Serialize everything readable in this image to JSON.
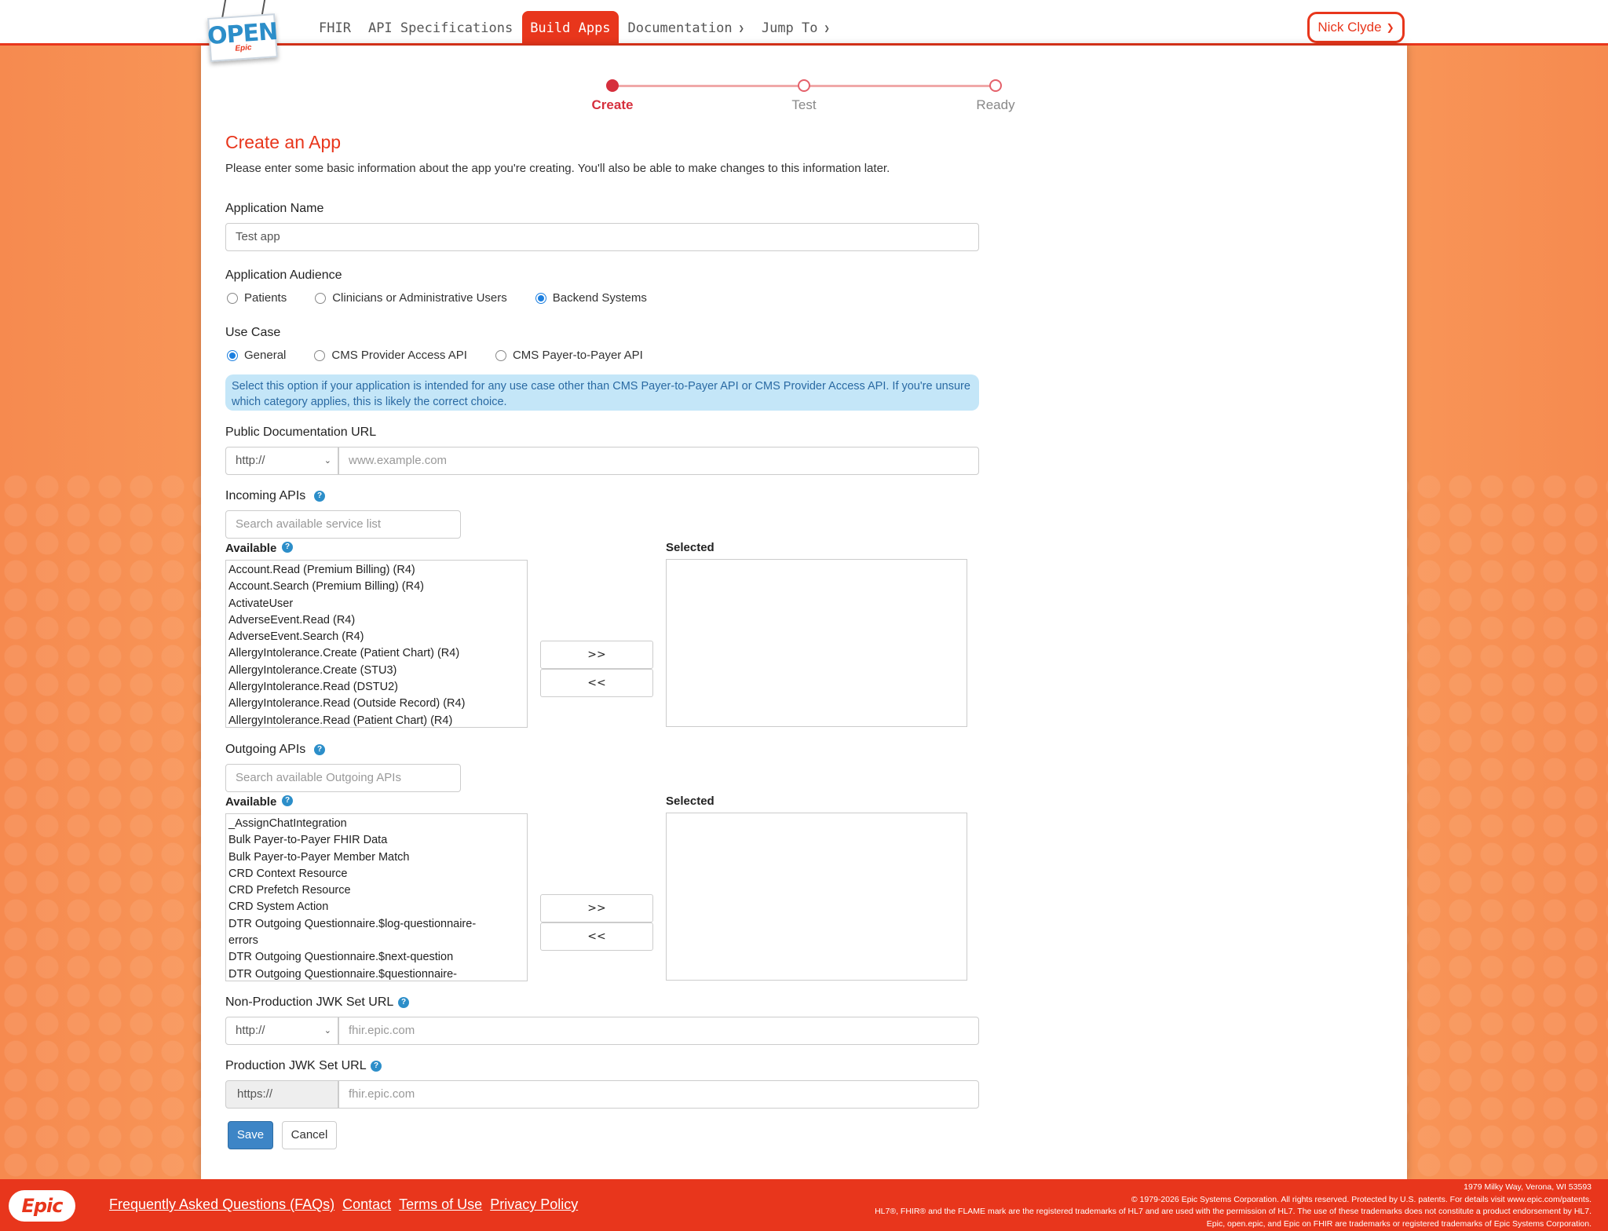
{
  "nav": {
    "logo_text": "OPEN",
    "logo_sub": "Epic",
    "items": [
      {
        "label": "FHIR"
      },
      {
        "label": "API Specifications"
      },
      {
        "label": "Build Apps"
      },
      {
        "label": "Documentation"
      },
      {
        "label": "Jump To"
      }
    ],
    "user": "Nick Clyde"
  },
  "stepper": {
    "steps": [
      "Create",
      "Test",
      "Ready"
    ],
    "current": "Create"
  },
  "form": {
    "title": "Create an App",
    "intro": "Please enter some basic information about the app you're creating. You'll also be able to make changes to this information later.",
    "app_name_label": "Application Name",
    "app_name_value": "Test app",
    "audience_label": "Application Audience",
    "audience_options": [
      "Patients",
      "Clinicians or Administrative Users",
      "Backend Systems"
    ],
    "audience_selected": "Backend Systems",
    "use_case_label": "Use Case",
    "use_case_options": [
      "General",
      "CMS Provider Access API",
      "CMS Payer-to-Payer API"
    ],
    "use_case_selected": "General",
    "use_case_info": "Select this option if your application is intended for any use case other than CMS Payer-to-Payer API or CMS Provider Access API. If you're unsure which category applies, this is likely the correct choice.",
    "doc_url_label": "Public Documentation URL",
    "doc_url_protocol": "http://",
    "doc_url_placeholder": "www.example.com",
    "incoming": {
      "label": "Incoming APIs",
      "search_placeholder": "Search available service list",
      "available_label": "Available",
      "selected_label": "Selected",
      "available": [
        "Account.Read (Premium Billing) (R4)",
        "Account.Search (Premium Billing) (R4)",
        "ActivateUser",
        "AdverseEvent.Read (R4)",
        "AdverseEvent.Search (R4)",
        "AllergyIntolerance.Create (Patient Chart) (R4)",
        "AllergyIntolerance.Create (STU3)",
        "AllergyIntolerance.Read (DSTU2)",
        "AllergyIntolerance.Read (Outside Record) (R4)",
        "AllergyIntolerance.Read (Patient Chart) (R4)"
      ],
      "add_label": ">>",
      "remove_label": "<<"
    },
    "outgoing": {
      "label": "Outgoing APIs",
      "search_placeholder": "Search available Outgoing APIs",
      "available_label": "Available",
      "selected_label": "Selected",
      "available": [
        "_AssignChatIntegration",
        "Bulk Payer-to-Payer FHIR Data",
        "Bulk Payer-to-Payer Member Match",
        "CRD Context Resource",
        "CRD Prefetch Resource",
        "CRD System Action",
        "DTR Outgoing Questionnaire.$log-questionnaire-errors",
        "DTR Outgoing Questionnaire.$next-question",
        "DTR Outgoing Questionnaire.$questionnaire-"
      ],
      "add_label": ">>",
      "remove_label": "<<"
    },
    "nonprod_jwk_label": "Non-Production JWK Set URL",
    "nonprod_jwk_protocol": "http://",
    "nonprod_jwk_placeholder": "fhir.epic.com",
    "prod_jwk_label": "Production JWK Set URL",
    "prod_jwk_protocol": "https://",
    "prod_jwk_placeholder": "fhir.epic.com",
    "save_label": "Save",
    "cancel_label": "Cancel"
  },
  "footer": {
    "logo": "Epic",
    "links": [
      "Frequently Asked Questions (FAQs)",
      "Contact",
      "Terms of Use",
      "Privacy Policy"
    ],
    "address": "1979 Milky Way, Verona, WI 53593",
    "copyright": "© 1979-2026 Epic Systems Corporation. All rights reserved. Protected by U.S. patents. For details visit www.epic.com/patents.",
    "hl7": "HL7®, FHIR® and the FLAME mark are the registered trademarks of HL7 and are used with the permission of HL7. The use of these trademarks does not constitute a product endorsement by HL7.",
    "trademarks": "Epic, open.epic, and Epic on FHIR are trademarks or registered trademarks of Epic Systems Corporation."
  },
  "colors": {
    "brand": "#e8361c",
    "accent_blue": "#3d85c6",
    "stepper_active": "#d62f3d",
    "info_bg": "#c4e6f8"
  },
  "icons": [
    "chevron-down-icon",
    "help-icon",
    "radio-icon"
  ]
}
